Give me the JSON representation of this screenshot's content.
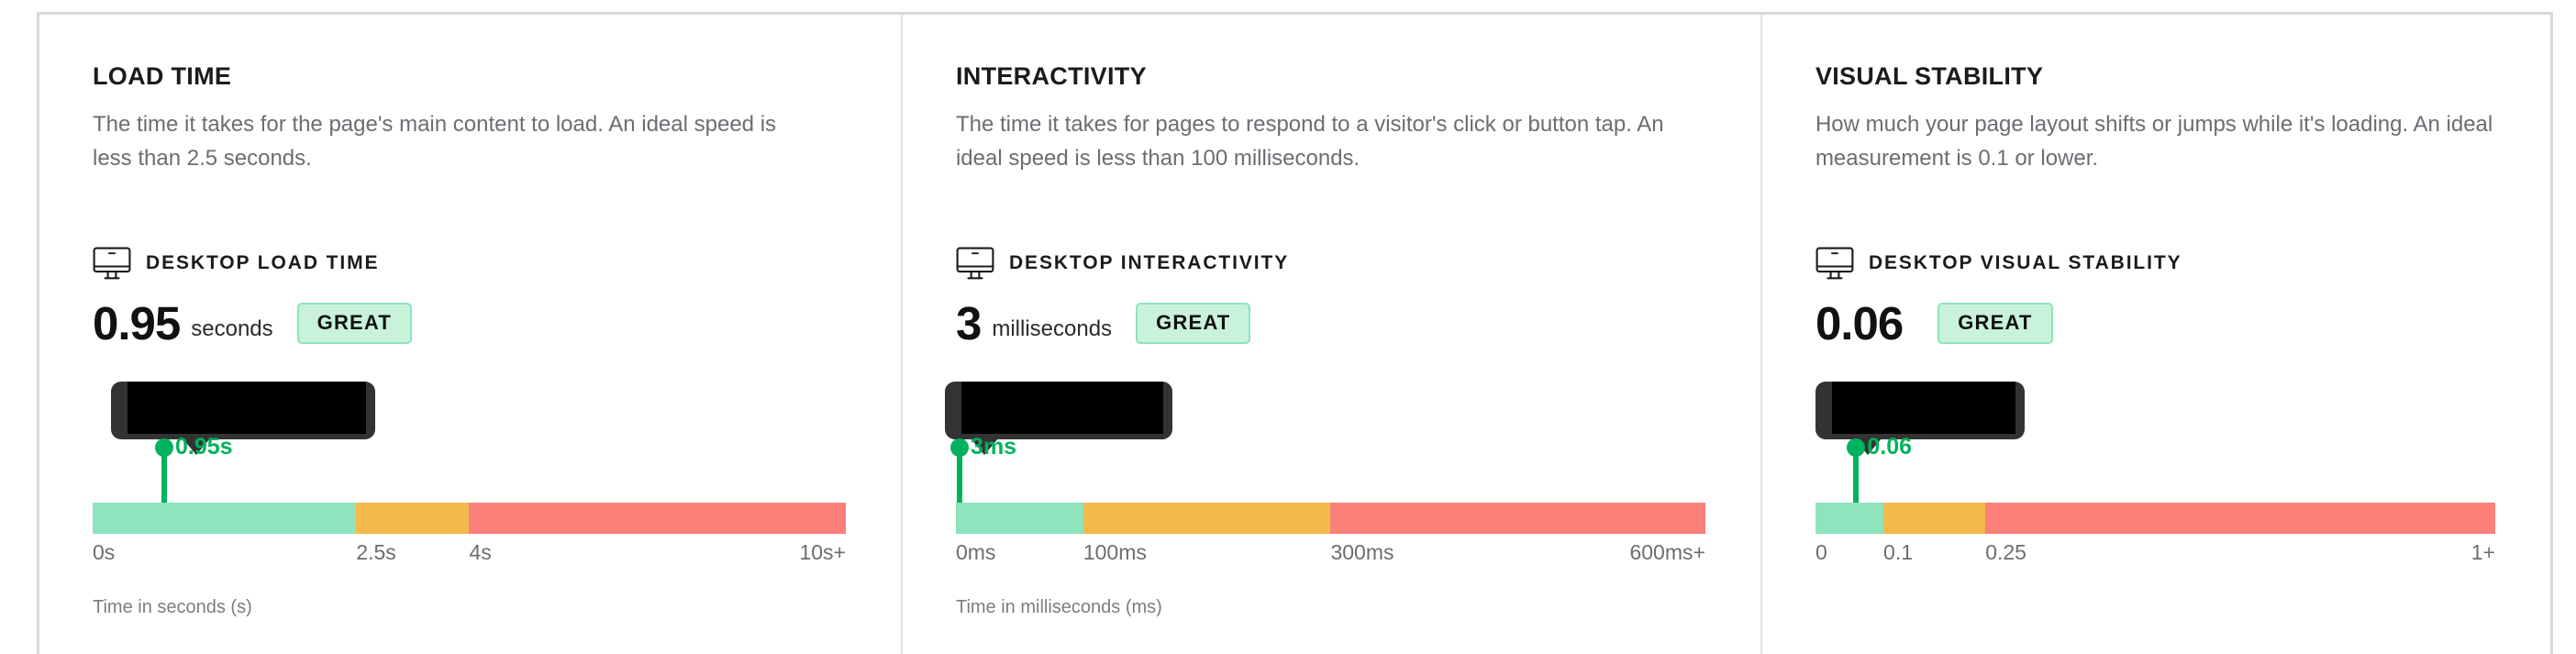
{
  "theme": {
    "good_color": "#8fe3bd",
    "ok_color": "#f3b94d",
    "bad_color": "#fa8079",
    "marker_color": "#00b25d",
    "badge_bg": "#c8f2da",
    "badge_border": "#8fe3bd",
    "border_color": "#d5d9dd",
    "divider_color": "#e2e5e8",
    "text_muted": "#6a6e72",
    "tooltip_bg": "#333333"
  },
  "columns": [
    {
      "title": "LOAD TIME",
      "description": "The time it takes for the page's main content to load. An ideal speed is less than 2.5 seconds.",
      "device_icon": "desktop-monitor-icon",
      "device_label": "DESKTOP LOAD TIME",
      "value": "0.95",
      "unit": "seconds",
      "rating": "GREAT",
      "marker_label": "0.95s",
      "axis_note": "Time in seconds (s)",
      "chart_data": {
        "type": "bar",
        "title": "Desktop Load Time",
        "orientation": "horizontal",
        "xlabel": "Time in seconds (s)",
        "xlim": [
          0,
          10
        ],
        "grid": false,
        "legend": false,
        "tick_labels": [
          "0s",
          "2.5s",
          "4s",
          "10s+"
        ],
        "tick_positions_pct": [
          0,
          35,
          50,
          100
        ],
        "segments": [
          {
            "name": "good",
            "from": 0,
            "to": 2.5,
            "width_pct": 35,
            "color": "#8fe3bd"
          },
          {
            "name": "needs improvement",
            "from": 2.5,
            "to": 4,
            "width_pct": 15,
            "color": "#f3b94d"
          },
          {
            "name": "poor",
            "from": 4,
            "to": 10,
            "width_pct": 50,
            "color": "#fa8079"
          }
        ],
        "marker": {
          "value": 0.95,
          "label": "0.95s",
          "position_pct": 9.5,
          "color": "#00b25d"
        }
      }
    },
    {
      "title": "INTERACTIVITY",
      "description": "The time it takes for pages to respond to a visitor's click or button tap. An ideal speed is less than 100 milliseconds.",
      "device_icon": "desktop-monitor-icon",
      "device_label": "DESKTOP INTERACTIVITY",
      "value": "3",
      "unit": "milliseconds",
      "rating": "GREAT",
      "marker_label": "3ms",
      "axis_note": "Time in milliseconds (ms)",
      "chart_data": {
        "type": "bar",
        "title": "Desktop Interactivity",
        "orientation": "horizontal",
        "xlabel": "Time in milliseconds (ms)",
        "xlim": [
          0,
          600
        ],
        "grid": false,
        "legend": false,
        "tick_labels": [
          "0ms",
          "100ms",
          "300ms",
          "600ms+"
        ],
        "tick_positions_pct": [
          0,
          17,
          50,
          100
        ],
        "segments": [
          {
            "name": "good",
            "from": 0,
            "to": 100,
            "width_pct": 17,
            "color": "#8fe3bd"
          },
          {
            "name": "needs improvement",
            "from": 100,
            "to": 300,
            "width_pct": 33,
            "color": "#f3b94d"
          },
          {
            "name": "poor",
            "from": 300,
            "to": 600,
            "width_pct": 50,
            "color": "#fa8079"
          }
        ],
        "marker": {
          "value": 3,
          "label": "3ms",
          "position_pct": 0.5,
          "color": "#00b25d"
        }
      }
    },
    {
      "title": "VISUAL STABILITY",
      "description": "How much your page layout shifts or jumps while it's loading. An ideal measurement is 0.1 or lower.",
      "device_icon": "desktop-monitor-icon",
      "device_label": "DESKTOP VISUAL STABILITY",
      "value": "0.06",
      "unit": "",
      "rating": "GREAT",
      "marker_label": "0.06",
      "axis_note": "",
      "chart_data": {
        "type": "bar",
        "title": "Desktop Visual Stability",
        "orientation": "horizontal",
        "xlabel": "",
        "xlim": [
          0,
          1
        ],
        "grid": false,
        "legend": false,
        "tick_labels": [
          "0",
          "0.1",
          "0.25",
          "1+"
        ],
        "tick_positions_pct": [
          0,
          10,
          25,
          100
        ],
        "segments": [
          {
            "name": "good",
            "from": 0,
            "to": 0.1,
            "width_pct": 10,
            "color": "#8fe3bd"
          },
          {
            "name": "needs improvement",
            "from": 0.1,
            "to": 0.25,
            "width_pct": 15,
            "color": "#f3b94d"
          },
          {
            "name": "poor",
            "from": 0.25,
            "to": 1,
            "width_pct": 75,
            "color": "#fa8079"
          }
        ],
        "marker": {
          "value": 0.06,
          "label": "0.06",
          "position_pct": 6,
          "color": "#00b25d"
        }
      }
    }
  ]
}
